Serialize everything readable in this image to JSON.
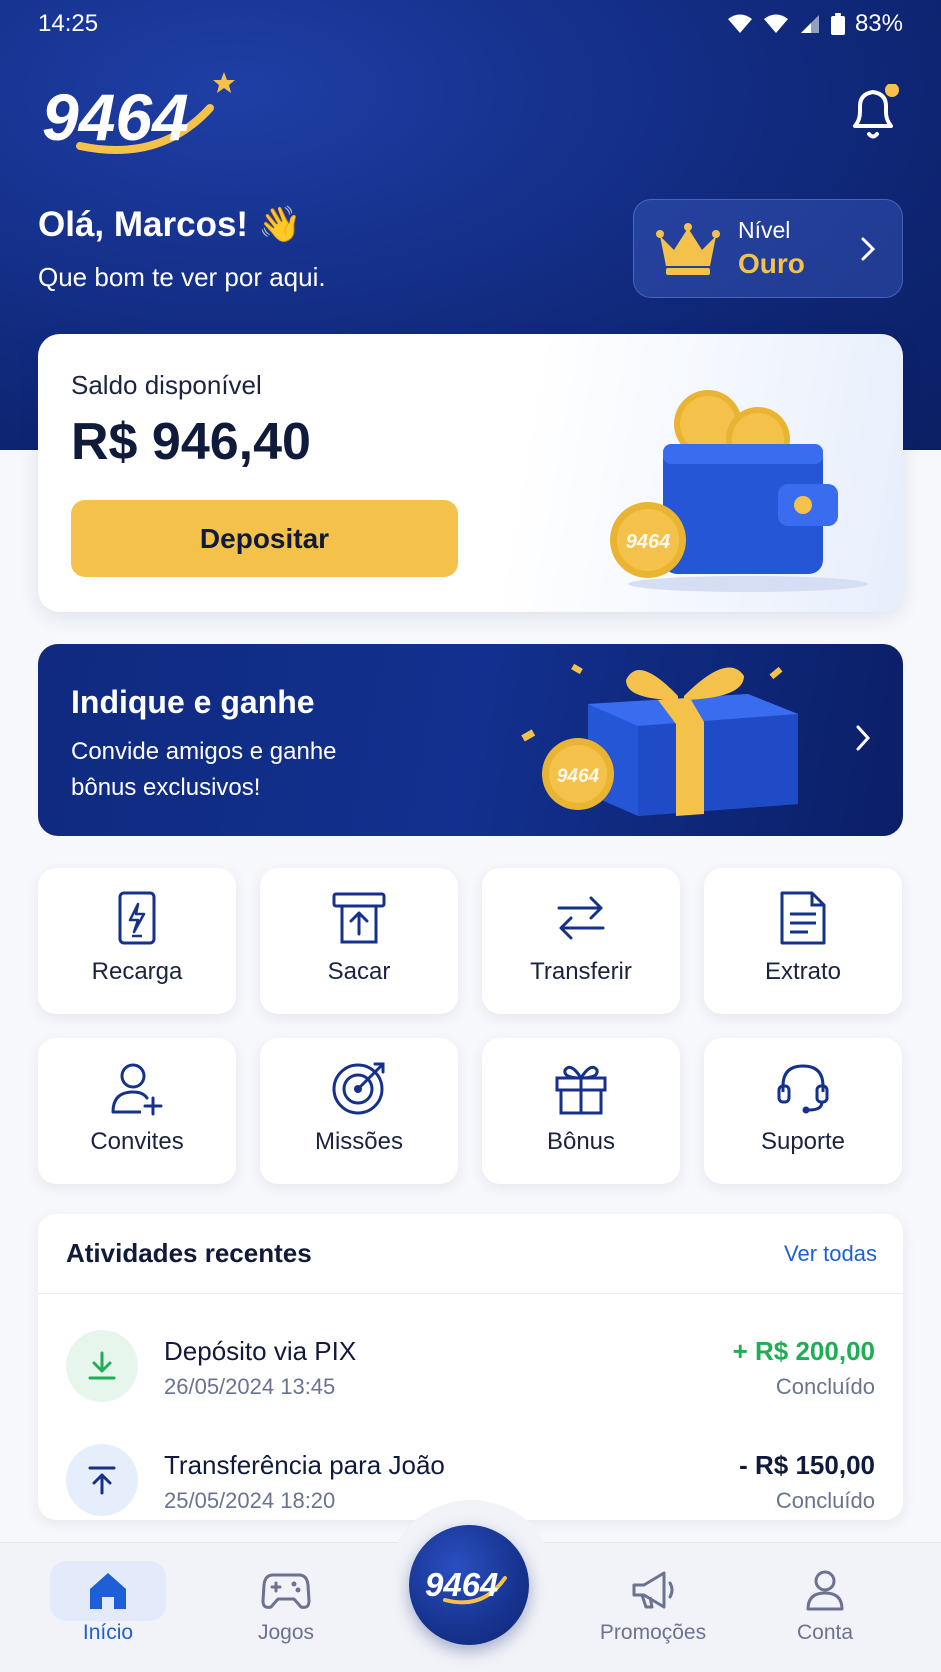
{
  "status_bar": {
    "time": "14:25",
    "battery": "83%"
  },
  "header": {
    "logo_text": "9464",
    "greeting": "Olá, Marcos!",
    "greeting_emoji": "👋",
    "subtitle": "Que bom te ver por aqui.",
    "level": {
      "label": "Nível",
      "value": "Ouro"
    }
  },
  "balance": {
    "label": "Saldo disponível",
    "amount": "R$ 946,40",
    "deposit_label": "Depositar",
    "coin_text": "9464"
  },
  "referral": {
    "title": "Indique e ganhe",
    "description": "Convide amigos e ganhe bônus exclusivos!",
    "coin_text": "9464"
  },
  "actions": [
    {
      "label": "Recarga",
      "icon": "phone-bolt-icon"
    },
    {
      "label": "Sacar",
      "icon": "withdraw-icon"
    },
    {
      "label": "Transferir",
      "icon": "transfer-arrows-icon"
    },
    {
      "label": "Extrato",
      "icon": "statement-icon"
    },
    {
      "label": "Convites",
      "icon": "user-plus-icon"
    },
    {
      "label": "Missões",
      "icon": "target-icon"
    },
    {
      "label": "Bônus",
      "icon": "gift-icon"
    },
    {
      "label": "Suporte",
      "icon": "headset-icon"
    }
  ],
  "activity": {
    "title": "Atividades recentes",
    "see_all": "Ver todas",
    "items": [
      {
        "title": "Depósito via PIX",
        "date": "26/05/2024 13:45",
        "amount": "+ R$ 200,00",
        "status": "Concluído",
        "amount_color": "#1fae55",
        "icon": "download-icon"
      },
      {
        "title": "Transferência para João",
        "date": "25/05/2024 18:20",
        "amount": "- R$ 150,00",
        "status": "Concluído",
        "amount_color": "#101a3a",
        "icon": "upload-icon"
      }
    ]
  },
  "nav": {
    "items": [
      {
        "label": "Início",
        "icon": "home-icon",
        "active": true
      },
      {
        "label": "Jogos",
        "icon": "gamepad-icon",
        "active": false
      },
      {
        "label": "Promoções",
        "icon": "megaphone-icon",
        "active": false
      },
      {
        "label": "Conta",
        "icon": "user-icon",
        "active": false
      }
    ],
    "center_logo": "9464"
  },
  "colors": {
    "primary": "#15318c",
    "accent": "#f4c24a",
    "link": "#1f5fd6",
    "positive": "#1fae55"
  }
}
